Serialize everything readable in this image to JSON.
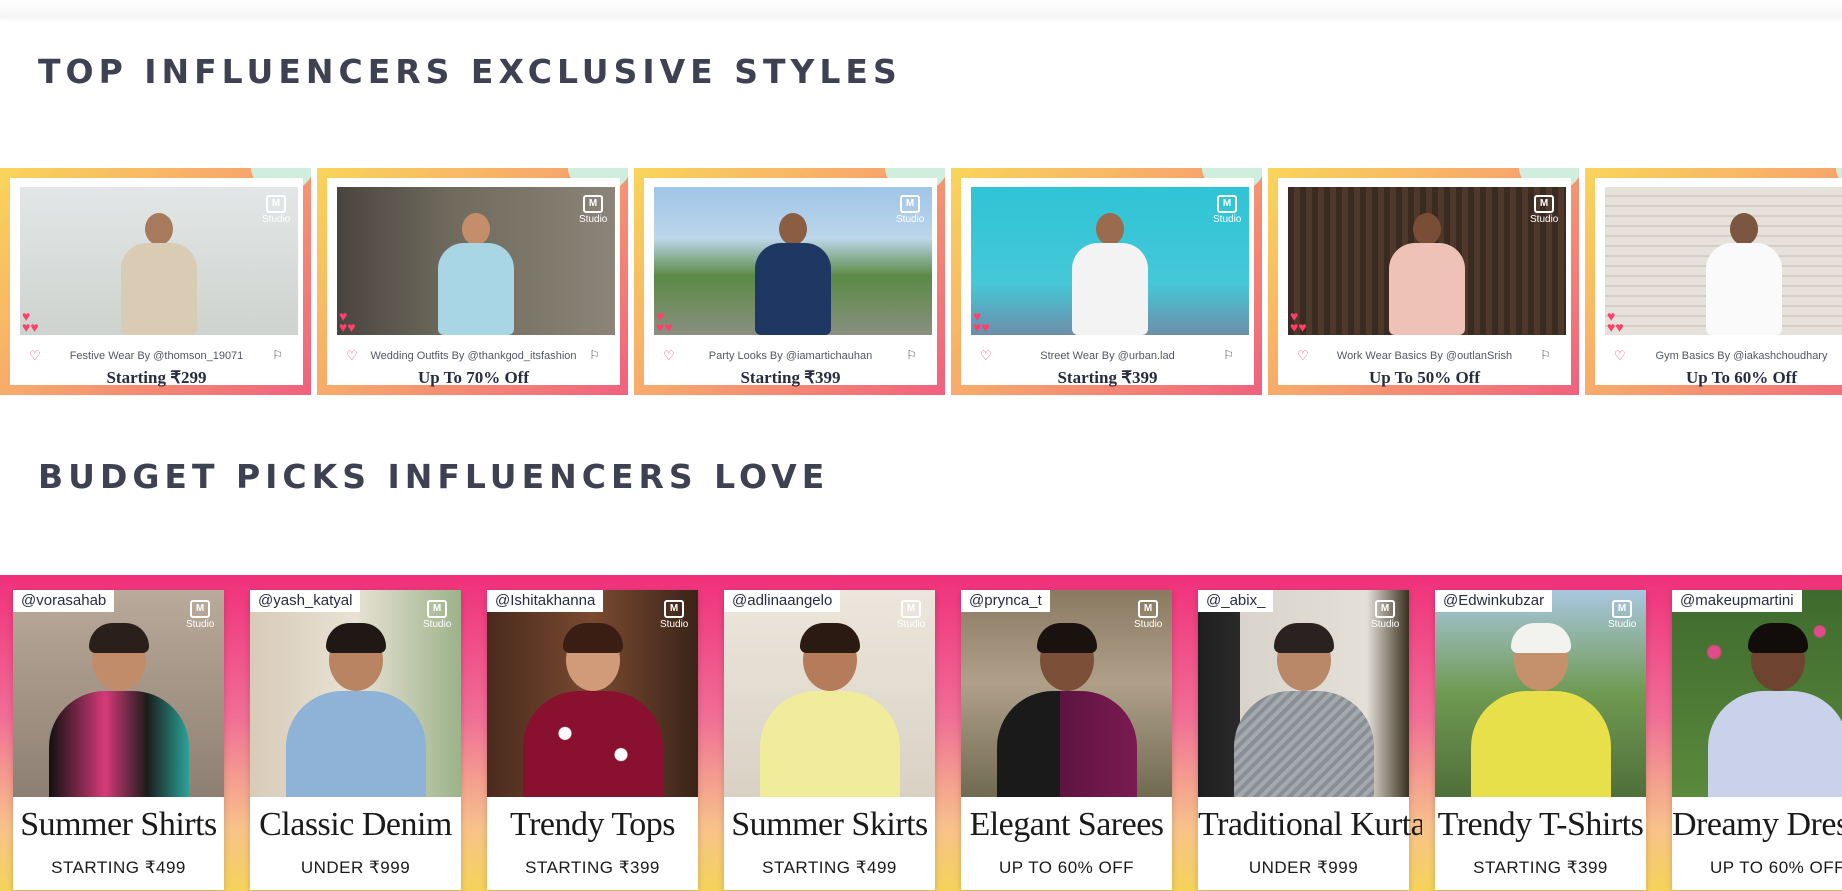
{
  "sections": [
    {
      "title": "TOP INFLUENCERS EXCLUSIVE STYLES"
    },
    {
      "title": "BUDGET PICKS INFLUENCERS LOVE"
    }
  ],
  "studio_badge": {
    "icon": "myntra-m-logo-icon",
    "label": "Studio",
    "mark": "M"
  },
  "influencer_styles": [
    {
      "caption": "Festive Wear By @thomson_19071",
      "offer": "Starting ₹299"
    },
    {
      "caption": "Wedding Outfits By @thankgod_itsfashion",
      "offer": "Up To 70% Off"
    },
    {
      "caption": "Party Looks By @iamartichauhan",
      "offer": "Starting ₹399"
    },
    {
      "caption": "Street Wear By @urban.lad",
      "offer": "Starting ₹399"
    },
    {
      "caption": "Work Wear Basics By @outlanSrish",
      "offer": "Up To 50% Off"
    },
    {
      "caption": "Gym Basics By @iakashchoudhary",
      "offer": "Up To 60% Off"
    }
  ],
  "budget_picks": [
    {
      "handle": "@vorasahab",
      "title": "Summer Shirts",
      "subtitle": "STARTING ₹499"
    },
    {
      "handle": "@yash_katyal",
      "title": "Classic Denim",
      "subtitle": "UNDER ₹999"
    },
    {
      "handle": "@Ishitakhanna",
      "title": "Trendy Tops",
      "subtitle": "STARTING ₹399"
    },
    {
      "handle": "@adlinaangelo",
      "title": "Summer Skirts",
      "subtitle": "STARTING ₹499"
    },
    {
      "handle": "@prynca_t",
      "title": "Elegant Sarees",
      "subtitle": "UP TO 60% OFF"
    },
    {
      "handle": "@_abix_",
      "title": "Traditional Kurtas",
      "subtitle": "UNDER ₹999"
    },
    {
      "handle": "@Edwinkubzar",
      "title": "Trendy T-Shirts",
      "subtitle": "STARTING ₹399"
    },
    {
      "handle": "@makeupmartini",
      "title": "Dreamy Dresses",
      "subtitle": "UP TO 60% OFF"
    }
  ],
  "colors": {
    "accent_pink": "#ff3f6c",
    "heading": "#3e4152"
  }
}
